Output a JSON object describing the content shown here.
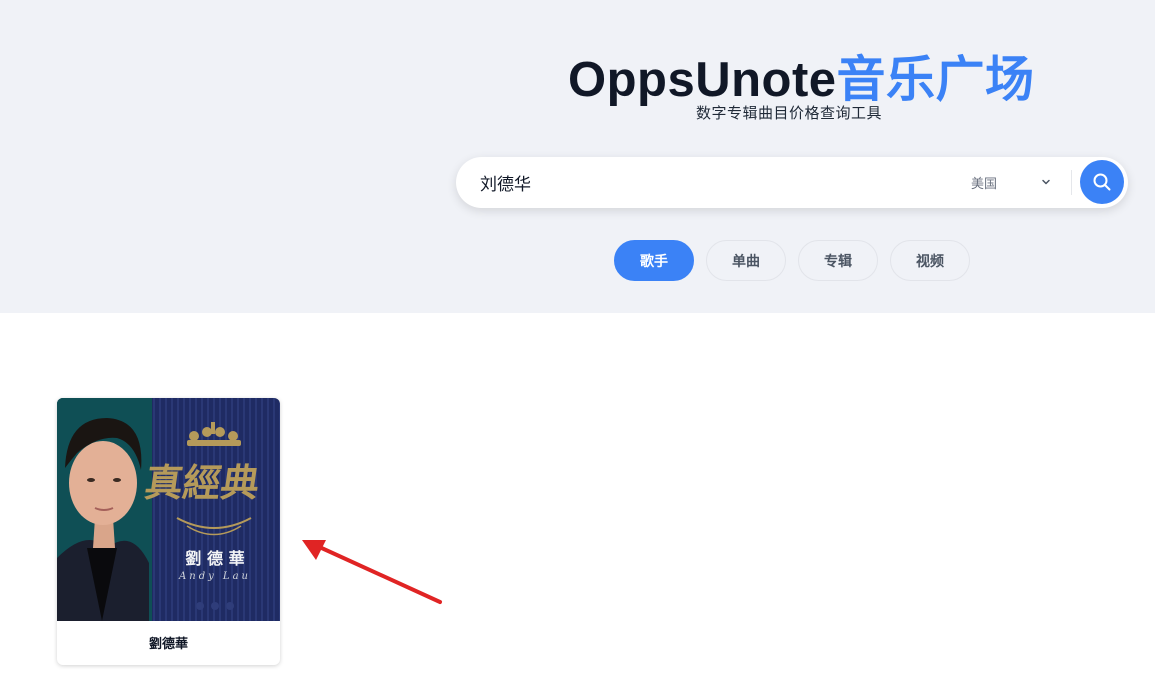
{
  "header": {
    "title_main": "OppsUnote",
    "title_accent": "音乐广场",
    "subtitle": "数字专辑曲目价格查询工具"
  },
  "search": {
    "value": "刘德华",
    "region": "美国",
    "search_icon": "search-icon",
    "dropdown_icon": "chevron-down-icon"
  },
  "tabs": [
    {
      "label": "歌手",
      "active": true
    },
    {
      "label": "单曲",
      "active": false
    },
    {
      "label": "专辑",
      "active": false
    },
    {
      "label": "视频",
      "active": false
    }
  ],
  "results": [
    {
      "name": "劉德華",
      "cover": {
        "chinese_name": "劉 德 華",
        "english_name": "Andy Lau",
        "logo_text": "真經典"
      }
    }
  ],
  "annotation": {
    "icon": "red-arrow-icon",
    "color": "#e02424"
  },
  "colors": {
    "accent": "#3b82f6",
    "hero_bg": "#f0f2f7",
    "title": "#111827"
  }
}
